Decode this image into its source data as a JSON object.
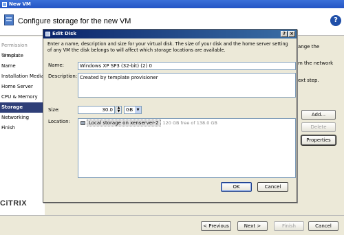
{
  "wizard": {
    "window_title": "New VM",
    "header_title": "Configure storage for the new VM",
    "help_label": "?",
    "sidebar": [
      {
        "label": "Permission Checks",
        "state": "dim"
      },
      {
        "label": "Template",
        "state": "normal"
      },
      {
        "label": "Name",
        "state": "normal"
      },
      {
        "label": "Installation Media",
        "state": "normal"
      },
      {
        "label": "Home Server",
        "state": "normal"
      },
      {
        "label": "CPU & Memory",
        "state": "normal"
      },
      {
        "label": "Storage",
        "state": "active"
      },
      {
        "label": "Networking",
        "state": "normal"
      },
      {
        "label": "Finish",
        "state": "normal"
      }
    ],
    "logo_text": "CiTRIX",
    "background_text": {
      "line1": "ange the",
      "line2": "m the network",
      "line3": "ext step."
    },
    "side_buttons": {
      "add": "Add...",
      "delete": "Delete",
      "properties": "Properties"
    },
    "footer": {
      "previous": "< Previous",
      "next": "Next >",
      "finish": "Finish",
      "cancel": "Cancel"
    }
  },
  "dialog": {
    "title": "Edit Disk",
    "help_btn": "?",
    "close_btn": "×",
    "instructions": "Enter a name, description and size for your virtual disk. The size of your disk and the home server setting of any VM the disk belongs to will affect which storage locations are available.",
    "name_label": "Name:",
    "name_value": "Windows XP SP3 (32-bit) (2) 0",
    "description_label": "Description:",
    "description_value": "Created by template provisioner",
    "size_label": "Size:",
    "size_value": "30.0",
    "size_unit": "GB",
    "location_label": "Location:",
    "location": {
      "name": "Local storage on xenserver-2",
      "free": "120 GB free of 138.0 GB"
    },
    "ok_label": "OK",
    "cancel_label": "Cancel"
  },
  "colors": {
    "sidebar_active_bg": "#2f3f78",
    "dialog_title_start": "#0a246a",
    "dialog_title_end": "#3a6ea5",
    "window_bg": "#ece9d8"
  }
}
